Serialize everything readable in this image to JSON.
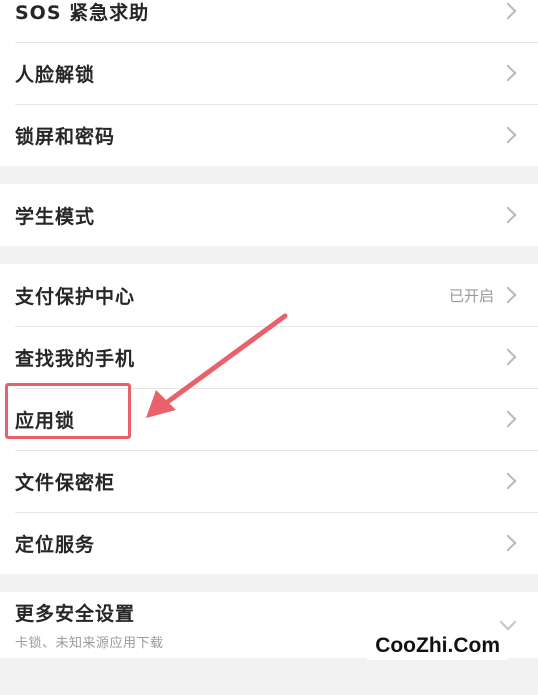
{
  "group1": [
    {
      "label": "SOS 紧急求助"
    },
    {
      "label": "人脸解锁"
    },
    {
      "label": "锁屏和密码"
    }
  ],
  "group2": [
    {
      "label": "学生模式"
    }
  ],
  "group3": [
    {
      "label": "支付保护中心",
      "value": "已开启"
    },
    {
      "label": "查找我的手机"
    },
    {
      "label": "应用锁"
    },
    {
      "label": "文件保密柜"
    },
    {
      "label": "定位服务"
    }
  ],
  "group4": {
    "label": "更多安全设置",
    "sub": "卡锁、未知来源应用下载"
  },
  "watermark": "CooZhi.Com",
  "colors": {
    "annotation": "#e8616b",
    "background": "#f2f2f2"
  }
}
